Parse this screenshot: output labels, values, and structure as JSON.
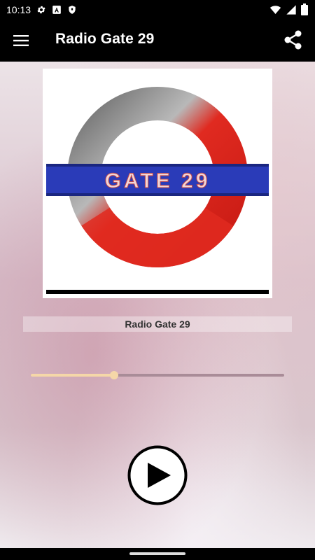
{
  "status_bar": {
    "time": "10:13"
  },
  "app_bar": {
    "title": "Radio Gate 29"
  },
  "player": {
    "artwork_text": "GATE 29",
    "station_name": "Radio Gate 29",
    "volume_fraction": 0.33
  },
  "colors": {
    "accent": "#f5d7a8",
    "bar_bg": "#000000",
    "logo_red": "#d8251c",
    "logo_blue": "#2a3bb8"
  },
  "icons": {
    "status": [
      "settings-icon",
      "a-notification-icon",
      "shield-icon",
      "wifi-icon",
      "signal-icon",
      "battery-icon"
    ],
    "app_bar": [
      "menu-icon",
      "share-icon"
    ],
    "player": [
      "play-icon"
    ]
  }
}
